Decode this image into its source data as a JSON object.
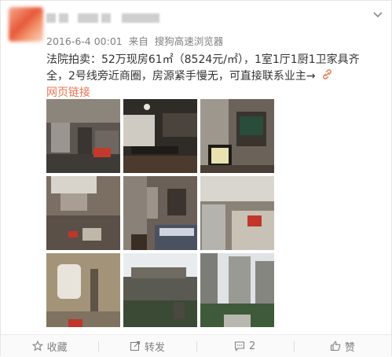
{
  "post": {
    "timestamp": "2016-6-4 00:01",
    "source_prefix": "来自",
    "source": "搜狗高速浏览器",
    "text": "法院拍卖：52万现房61㎡（8524元/㎡），1室1厅1厨1卫家具齐全，2号线旁近商圈，房源紧手慢无，可直接联系业主→",
    "link_label": "网页链接"
  },
  "photos": [
    {
      "name": "photo-living-room"
    },
    {
      "name": "photo-dining-area"
    },
    {
      "name": "photo-tv-corner"
    },
    {
      "name": "photo-kitchen"
    },
    {
      "name": "photo-bedroom"
    },
    {
      "name": "photo-fridge-kitchen"
    },
    {
      "name": "photo-bathroom"
    },
    {
      "name": "photo-building-exterior"
    },
    {
      "name": "photo-tower-view"
    }
  ],
  "toolbar": {
    "favorite_label": "收藏",
    "repost_label": "转发",
    "comment_count": "2",
    "like_label": "赞"
  },
  "icons": {
    "more": "chevron-down-icon",
    "link": "link-icon",
    "favorite": "star-icon",
    "repost": "repost-icon",
    "comment": "comment-icon",
    "like": "thumbs-up-icon"
  },
  "colors": {
    "link": "#eb7350",
    "meta": "#808080"
  }
}
